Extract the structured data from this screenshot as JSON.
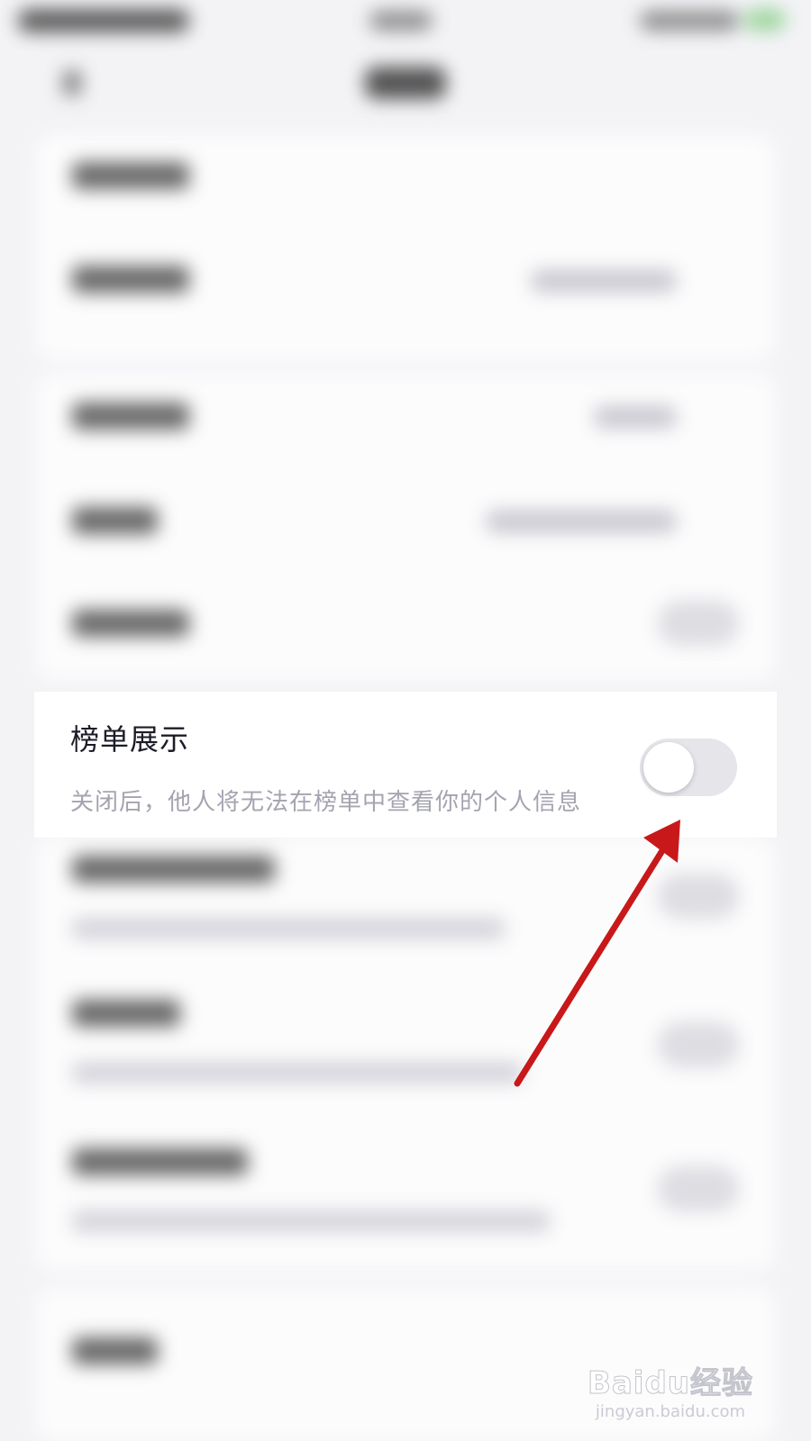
{
  "setting": {
    "title": "榜单展示",
    "description": "关闭后，他人将无法在榜单中查看你的个人信息",
    "toggle_state": "off"
  },
  "watermark": {
    "logo": "Baidu经验",
    "url": "jingyan.baidu.com"
  },
  "colors": {
    "arrow": "#c8181a",
    "toggle_off": "#e5e5ea",
    "title_text": "#1c1c28",
    "description_text": "#a4a4b0"
  }
}
